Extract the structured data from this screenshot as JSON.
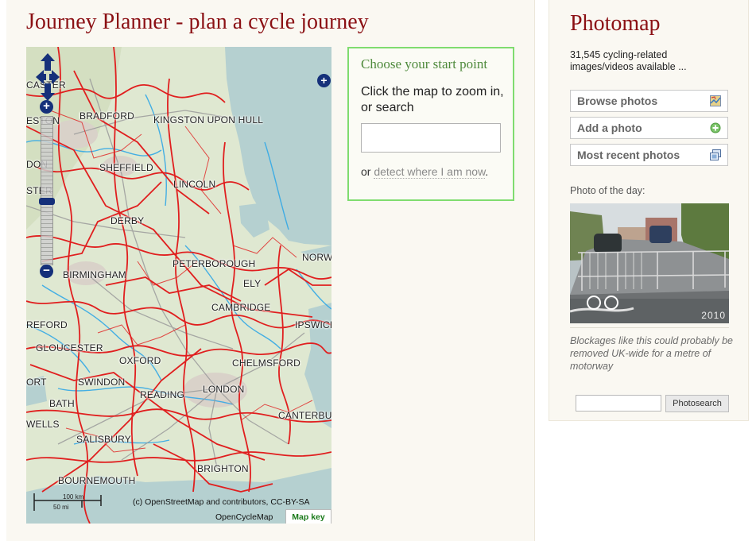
{
  "journey": {
    "title": "Journey Planner - plan a cycle journey",
    "start_box": {
      "title": "Choose your start point",
      "instructions": "Click the map to zoom in, or search",
      "search_placeholder": "",
      "or_text": "or",
      "detect_link": "detect where I am now",
      "period": "."
    },
    "map": {
      "places": [
        "CASTER",
        "BRADFORD",
        "KINGSTON UPON HULL",
        "ESTON",
        "SHEFFIELD",
        "DON",
        "LINCOLN",
        "STER",
        "DERBY",
        "PETERBOROUGH",
        "NORW",
        "BIRMINGHAM",
        "ELY",
        "CAMBRIDGE",
        "REFORD",
        "IPSWICH",
        "GLOUCESTER",
        "OXFORD",
        "CHELMSFORD",
        "ORT",
        "SWINDON",
        "READING",
        "LONDON",
        "BATH",
        "CANTERBU",
        "WELLS",
        "SALISBURY",
        "BRIGHTON",
        "BOURNEMOUTH"
      ],
      "scale_km": "100 km",
      "scale_mi": "50 mi",
      "attribution": "(c) OpenStreetMap and contributors, CC-BY-SA",
      "layer_label": "OpenCycleMap",
      "key_tab": "Map key",
      "zoom_in": "+",
      "zoom_out": "−",
      "layer_switch": "+"
    }
  },
  "photomap": {
    "title": "Photomap",
    "count_text": "31,545 cycling-related images/videos available ...",
    "buttons": [
      {
        "label": "Browse photos",
        "icon": "map-photo-icon"
      },
      {
        "label": "Add a photo",
        "icon": "add-circle-icon"
      },
      {
        "label": "Most recent photos",
        "icon": "photo-stack-icon"
      }
    ],
    "potd_label": "Photo of the day:",
    "potd_year": "2010",
    "potd_caption": "Blockages like this could probably be removed UK-wide for a metre of motorway",
    "search_button": "Photosearch",
    "search_placeholder": ""
  }
}
